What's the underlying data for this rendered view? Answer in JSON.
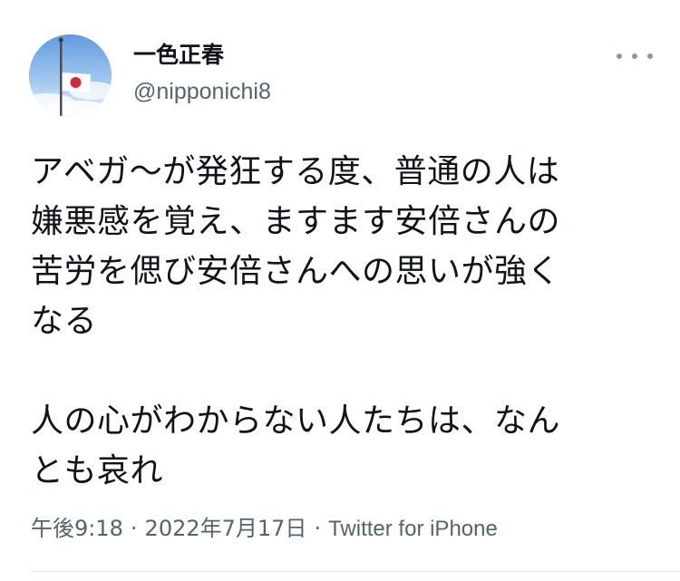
{
  "author": {
    "display_name": "一色正春",
    "handle": "@nipponichi8",
    "avatar_icon": "half-mast-japanese-flag-avatar"
  },
  "more_icon": "more-options-icon",
  "tweet": {
    "paragraph_1": "アベガ〜が発狂する度、普通の人は\n嫌悪感を覚え、ますます安倍さんの\n苦労を偲び安倍さんへの思いが強く\nなる",
    "paragraph_2": "人の心がわからない人たちは、なん\nとも哀れ"
  },
  "meta": {
    "time": "午後9:18",
    "separator": "·",
    "date": "2022年7月17日",
    "source": "Twitter for iPhone"
  },
  "colors": {
    "text": "#0f1419",
    "secondary": "#536471",
    "flag_red": "#d7263d"
  }
}
